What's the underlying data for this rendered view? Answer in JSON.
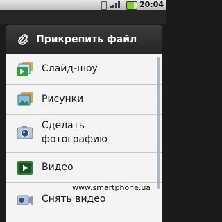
{
  "status_bar": {
    "time": "20:04",
    "icons": [
      "sim-card-icon",
      "signal-icon",
      "battery-icon"
    ],
    "battery_color": "#7ed321"
  },
  "dialog": {
    "title": "Прикрепить файл",
    "header_icon": "paperclip-icon",
    "items": [
      {
        "label": "Слайд-шоу",
        "icon": "slideshow-icon"
      },
      {
        "label": "Рисунки",
        "icon": "pictures-icon"
      },
      {
        "label_line1": "Сделать",
        "label_line2": "фотографию",
        "icon": "camera-icon"
      },
      {
        "label": "Видео",
        "icon": "video-icon"
      },
      {
        "label": "Снять видео",
        "icon": "camcorder-icon"
      }
    ]
  },
  "watermark": "www.smartphone.ua",
  "colors": {
    "header_bg": "#2f2f2f",
    "list_bg": "#f4f4f4",
    "text": "#1a1a1a"
  }
}
